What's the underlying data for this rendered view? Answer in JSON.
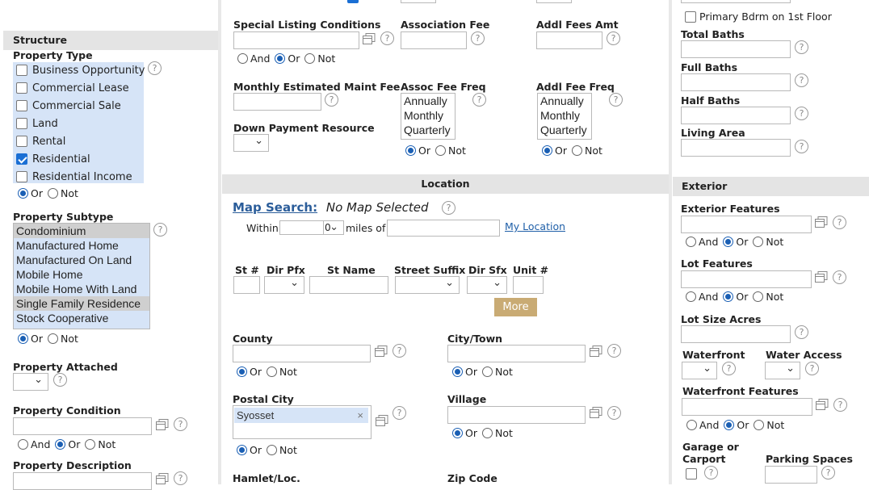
{
  "left": {
    "structure_header": "Structure",
    "property_type": {
      "label": "Property Type",
      "options": [
        {
          "label": "Business Opportunity",
          "checked": false
        },
        {
          "label": "Commercial Lease",
          "checked": false
        },
        {
          "label": "Commercial Sale",
          "checked": false
        },
        {
          "label": "Land",
          "checked": false
        },
        {
          "label": "Rental",
          "checked": false
        },
        {
          "label": "Residential",
          "checked": true
        },
        {
          "label": "Residential Income",
          "checked": false
        }
      ],
      "or": "Or",
      "not": "Not"
    },
    "property_subtype": {
      "label": "Property Subtype",
      "options": [
        "Condominium",
        "Manufactured Home",
        "Manufactured On Land",
        "Mobile Home",
        "Mobile Home With Land",
        "Single Family Residence",
        "Stock Cooperative"
      ],
      "selected": [
        "Condominium",
        "Single Family Residence"
      ],
      "or": "Or",
      "not": "Not"
    },
    "property_attached": {
      "label": "Property Attached"
    },
    "property_condition": {
      "label": "Property Condition",
      "and": "And",
      "or": "Or",
      "not": "Not"
    },
    "property_description": {
      "label": "Property Description"
    }
  },
  "middle": {
    "special_listing": {
      "label": "Special Listing Conditions",
      "and": "And",
      "or": "Or",
      "not": "Not"
    },
    "association_fee": {
      "label": "Association Fee"
    },
    "addl_fees_amt": {
      "label": "Addl Fees Amt"
    },
    "monthly_maint_fee": {
      "label": "Monthly Estimated Maint Fee"
    },
    "assoc_fee_freq": {
      "label": "Assoc Fee Freq",
      "options": [
        "Annually",
        "Monthly",
        "Quarterly"
      ],
      "or": "Or",
      "not": "Not"
    },
    "addl_fee_freq": {
      "label": "Addl Fee Freq",
      "options": [
        "Annually",
        "Monthly",
        "Quarterly"
      ],
      "or": "Or",
      "not": "Not"
    },
    "down_payment": {
      "label": "Down Payment Resource"
    },
    "location_header": "Location",
    "map_search": {
      "link": "Map Search:",
      "status": "No Map Selected"
    },
    "within": {
      "label": "Within",
      "miles_of": "miles of",
      "my_location": "My Location",
      "value": "0"
    },
    "address": {
      "st_num": "St #",
      "dir_pfx": "Dir Pfx",
      "st_name": "St Name",
      "street_suffix": "Street Suffix",
      "dir_sfx": "Dir Sfx",
      "unit": "Unit #"
    },
    "more_button": "More",
    "county": {
      "label": "County",
      "or": "Or",
      "not": "Not"
    },
    "city_town": {
      "label": "City/Town",
      "or": "Or",
      "not": "Not"
    },
    "postal_city": {
      "label": "Postal City",
      "value": "Syosset",
      "or": "Or",
      "not": "Not"
    },
    "village": {
      "label": "Village",
      "or": "Or",
      "not": "Not"
    },
    "hamlet": {
      "label": "Hamlet/Loc."
    },
    "zip_code": {
      "label": "Zip Code"
    }
  },
  "right": {
    "primary_bdrm": "Primary Bdrm on 1st Floor",
    "total_baths": "Total Baths",
    "full_baths": "Full Baths",
    "half_baths": "Half Baths",
    "living_area": "Living Area",
    "exterior_header": "Exterior",
    "exterior_features": {
      "label": "Exterior Features",
      "and": "And",
      "or": "Or",
      "not": "Not"
    },
    "lot_features": {
      "label": "Lot Features",
      "and": "And",
      "or": "Or",
      "not": "Not"
    },
    "lot_size_acres": "Lot Size Acres",
    "waterfront": "Waterfront",
    "water_access": "Water Access",
    "waterfront_features": {
      "label": "Waterfront Features",
      "and": "And",
      "or": "Or",
      "not": "Not"
    },
    "garage_or": "Garage or",
    "carport": "Carport",
    "parking_spaces": "Parking Spaces"
  },
  "help_glyph": "?"
}
